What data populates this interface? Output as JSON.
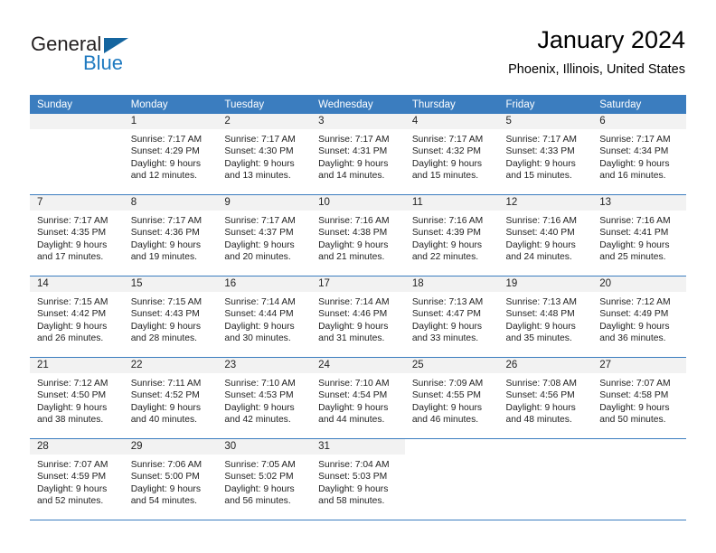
{
  "brand": {
    "name_top": "General",
    "name_bottom": "Blue",
    "accent_color": "#1f7ac0",
    "triangle_color": "#15659f"
  },
  "header": {
    "title": "January 2024",
    "subtitle": "Phoenix, Illinois, United States"
  },
  "theme": {
    "header_row_bg": "#3b7dbf",
    "daynum_band_bg": "#f2f2f2",
    "grid_line": "#3b7dbf",
    "text": "#222222"
  },
  "weekdays": [
    "Sunday",
    "Monday",
    "Tuesday",
    "Wednesday",
    "Thursday",
    "Friday",
    "Saturday"
  ],
  "weeks": [
    [
      {
        "day": "",
        "sunrise": "",
        "sunset": "",
        "daylight1": "",
        "daylight2": "",
        "empty": true
      },
      {
        "day": "1",
        "sunrise": "Sunrise: 7:17 AM",
        "sunset": "Sunset: 4:29 PM",
        "daylight1": "Daylight: 9 hours",
        "daylight2": "and 12 minutes."
      },
      {
        "day": "2",
        "sunrise": "Sunrise: 7:17 AM",
        "sunset": "Sunset: 4:30 PM",
        "daylight1": "Daylight: 9 hours",
        "daylight2": "and 13 minutes."
      },
      {
        "day": "3",
        "sunrise": "Sunrise: 7:17 AM",
        "sunset": "Sunset: 4:31 PM",
        "daylight1": "Daylight: 9 hours",
        "daylight2": "and 14 minutes."
      },
      {
        "day": "4",
        "sunrise": "Sunrise: 7:17 AM",
        "sunset": "Sunset: 4:32 PM",
        "daylight1": "Daylight: 9 hours",
        "daylight2": "and 15 minutes."
      },
      {
        "day": "5",
        "sunrise": "Sunrise: 7:17 AM",
        "sunset": "Sunset: 4:33 PM",
        "daylight1": "Daylight: 9 hours",
        "daylight2": "and 15 minutes."
      },
      {
        "day": "6",
        "sunrise": "Sunrise: 7:17 AM",
        "sunset": "Sunset: 4:34 PM",
        "daylight1": "Daylight: 9 hours",
        "daylight2": "and 16 minutes."
      }
    ],
    [
      {
        "day": "7",
        "sunrise": "Sunrise: 7:17 AM",
        "sunset": "Sunset: 4:35 PM",
        "daylight1": "Daylight: 9 hours",
        "daylight2": "and 17 minutes."
      },
      {
        "day": "8",
        "sunrise": "Sunrise: 7:17 AM",
        "sunset": "Sunset: 4:36 PM",
        "daylight1": "Daylight: 9 hours",
        "daylight2": "and 19 minutes."
      },
      {
        "day": "9",
        "sunrise": "Sunrise: 7:17 AM",
        "sunset": "Sunset: 4:37 PM",
        "daylight1": "Daylight: 9 hours",
        "daylight2": "and 20 minutes."
      },
      {
        "day": "10",
        "sunrise": "Sunrise: 7:16 AM",
        "sunset": "Sunset: 4:38 PM",
        "daylight1": "Daylight: 9 hours",
        "daylight2": "and 21 minutes."
      },
      {
        "day": "11",
        "sunrise": "Sunrise: 7:16 AM",
        "sunset": "Sunset: 4:39 PM",
        "daylight1": "Daylight: 9 hours",
        "daylight2": "and 22 minutes."
      },
      {
        "day": "12",
        "sunrise": "Sunrise: 7:16 AM",
        "sunset": "Sunset: 4:40 PM",
        "daylight1": "Daylight: 9 hours",
        "daylight2": "and 24 minutes."
      },
      {
        "day": "13",
        "sunrise": "Sunrise: 7:16 AM",
        "sunset": "Sunset: 4:41 PM",
        "daylight1": "Daylight: 9 hours",
        "daylight2": "and 25 minutes."
      }
    ],
    [
      {
        "day": "14",
        "sunrise": "Sunrise: 7:15 AM",
        "sunset": "Sunset: 4:42 PM",
        "daylight1": "Daylight: 9 hours",
        "daylight2": "and 26 minutes."
      },
      {
        "day": "15",
        "sunrise": "Sunrise: 7:15 AM",
        "sunset": "Sunset: 4:43 PM",
        "daylight1": "Daylight: 9 hours",
        "daylight2": "and 28 minutes."
      },
      {
        "day": "16",
        "sunrise": "Sunrise: 7:14 AM",
        "sunset": "Sunset: 4:44 PM",
        "daylight1": "Daylight: 9 hours",
        "daylight2": "and 30 minutes."
      },
      {
        "day": "17",
        "sunrise": "Sunrise: 7:14 AM",
        "sunset": "Sunset: 4:46 PM",
        "daylight1": "Daylight: 9 hours",
        "daylight2": "and 31 minutes."
      },
      {
        "day": "18",
        "sunrise": "Sunrise: 7:13 AM",
        "sunset": "Sunset: 4:47 PM",
        "daylight1": "Daylight: 9 hours",
        "daylight2": "and 33 minutes."
      },
      {
        "day": "19",
        "sunrise": "Sunrise: 7:13 AM",
        "sunset": "Sunset: 4:48 PM",
        "daylight1": "Daylight: 9 hours",
        "daylight2": "and 35 minutes."
      },
      {
        "day": "20",
        "sunrise": "Sunrise: 7:12 AM",
        "sunset": "Sunset: 4:49 PM",
        "daylight1": "Daylight: 9 hours",
        "daylight2": "and 36 minutes."
      }
    ],
    [
      {
        "day": "21",
        "sunrise": "Sunrise: 7:12 AM",
        "sunset": "Sunset: 4:50 PM",
        "daylight1": "Daylight: 9 hours",
        "daylight2": "and 38 minutes."
      },
      {
        "day": "22",
        "sunrise": "Sunrise: 7:11 AM",
        "sunset": "Sunset: 4:52 PM",
        "daylight1": "Daylight: 9 hours",
        "daylight2": "and 40 minutes."
      },
      {
        "day": "23",
        "sunrise": "Sunrise: 7:10 AM",
        "sunset": "Sunset: 4:53 PM",
        "daylight1": "Daylight: 9 hours",
        "daylight2": "and 42 minutes."
      },
      {
        "day": "24",
        "sunrise": "Sunrise: 7:10 AM",
        "sunset": "Sunset: 4:54 PM",
        "daylight1": "Daylight: 9 hours",
        "daylight2": "and 44 minutes."
      },
      {
        "day": "25",
        "sunrise": "Sunrise: 7:09 AM",
        "sunset": "Sunset: 4:55 PM",
        "daylight1": "Daylight: 9 hours",
        "daylight2": "and 46 minutes."
      },
      {
        "day": "26",
        "sunrise": "Sunrise: 7:08 AM",
        "sunset": "Sunset: 4:56 PM",
        "daylight1": "Daylight: 9 hours",
        "daylight2": "and 48 minutes."
      },
      {
        "day": "27",
        "sunrise": "Sunrise: 7:07 AM",
        "sunset": "Sunset: 4:58 PM",
        "daylight1": "Daylight: 9 hours",
        "daylight2": "and 50 minutes."
      }
    ],
    [
      {
        "day": "28",
        "sunrise": "Sunrise: 7:07 AM",
        "sunset": "Sunset: 4:59 PM",
        "daylight1": "Daylight: 9 hours",
        "daylight2": "and 52 minutes."
      },
      {
        "day": "29",
        "sunrise": "Sunrise: 7:06 AM",
        "sunset": "Sunset: 5:00 PM",
        "daylight1": "Daylight: 9 hours",
        "daylight2": "and 54 minutes."
      },
      {
        "day": "30",
        "sunrise": "Sunrise: 7:05 AM",
        "sunset": "Sunset: 5:02 PM",
        "daylight1": "Daylight: 9 hours",
        "daylight2": "and 56 minutes."
      },
      {
        "day": "31",
        "sunrise": "Sunrise: 7:04 AM",
        "sunset": "Sunset: 5:03 PM",
        "daylight1": "Daylight: 9 hours",
        "daylight2": "and 58 minutes."
      },
      {
        "day": "",
        "sunrise": "",
        "sunset": "",
        "daylight1": "",
        "daylight2": "",
        "blank": true
      },
      {
        "day": "",
        "sunrise": "",
        "sunset": "",
        "daylight1": "",
        "daylight2": "",
        "blank": true
      },
      {
        "day": "",
        "sunrise": "",
        "sunset": "",
        "daylight1": "",
        "daylight2": "",
        "blank": true
      }
    ]
  ]
}
